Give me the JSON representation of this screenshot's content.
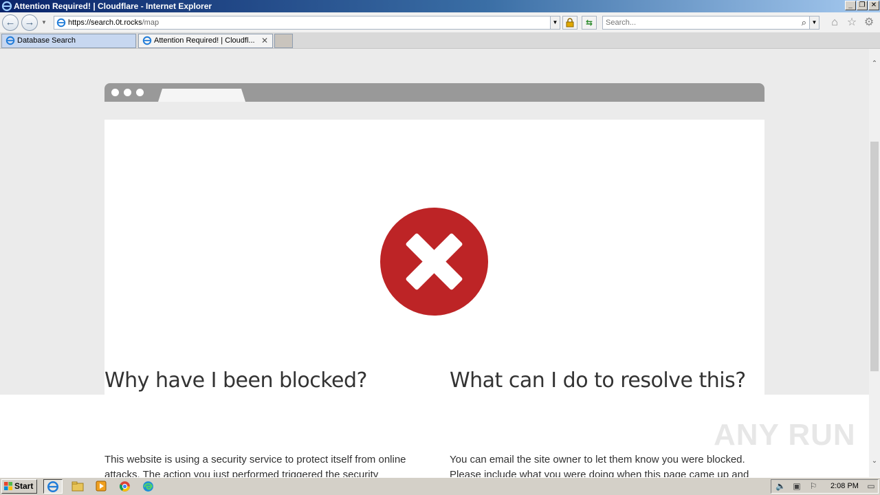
{
  "window": {
    "title": "Attention Required! | Cloudflare - Internet Explorer",
    "minimize": "_",
    "restore": "❐",
    "close": "✕"
  },
  "nav": {
    "back": "←",
    "forward": "→",
    "url_host": "https://search.0t.rocks",
    "url_path": "/map",
    "search_placeholder": "Search...",
    "search_icon": "⌕",
    "icons": [
      "home-icon",
      "favorites-star-icon",
      "settings-gear-icon"
    ]
  },
  "tabs": [
    {
      "label": "Database Search"
    },
    {
      "label": "Attention Required! | Cloudfl..."
    }
  ],
  "page": {
    "heading_left": "Why have I been blocked?",
    "heading_right": "What can I do to resolve this?",
    "para_left": "This website is using a security service to protect itself from online attacks. The action you just performed triggered the security",
    "para_right": "You can email the site owner to let them know you were blocked. Please include what you were doing when this page came up and the",
    "error_color": "#bd2426"
  },
  "watermark": "ANY RUN",
  "taskbar": {
    "start_label": "Start",
    "apps": [
      "internet-explorer-icon",
      "file-explorer-icon",
      "media-player-icon",
      "chrome-icon",
      "edge-icon"
    ],
    "clock": "2:08 PM"
  }
}
